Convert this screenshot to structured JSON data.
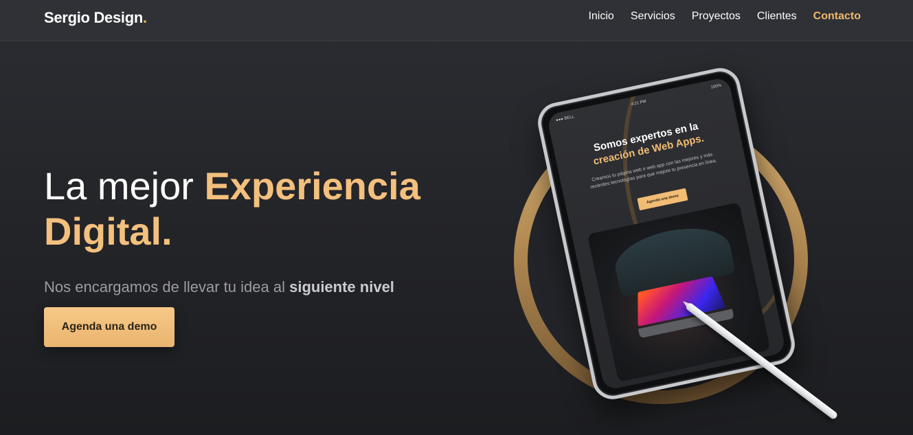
{
  "brand": {
    "name": "Sergio Design",
    "dot": "."
  },
  "nav": {
    "items": [
      {
        "label": "Inicio"
      },
      {
        "label": "Servicios"
      },
      {
        "label": "Proyectos"
      },
      {
        "label": "Clientes"
      },
      {
        "label": "Contacto",
        "active": true
      }
    ]
  },
  "hero": {
    "title_lead": "La mejor ",
    "title_accent_1": "Experiencia",
    "title_accent_2": "Digital.",
    "subtitle_lead": "Nos encargamos de llevar tu idea al ",
    "subtitle_bold": "siguiente nivel",
    "cta_label": "Agenda una demo"
  },
  "tablet": {
    "status_left": "●●● BELL",
    "status_time": "4:21 PM",
    "status_right": "100%",
    "headline_lead": "Somos expertos en la",
    "headline_accent": "creación de Web Apps.",
    "body": "Creamos tu página web o web app con las mejores y más recientes tecnologías para que mejore tu presencia en línea.",
    "cta_label": "Agenda una demo"
  },
  "colors": {
    "accent": "#f0b96a",
    "background": "#232428",
    "navbar": "#2f3136"
  }
}
